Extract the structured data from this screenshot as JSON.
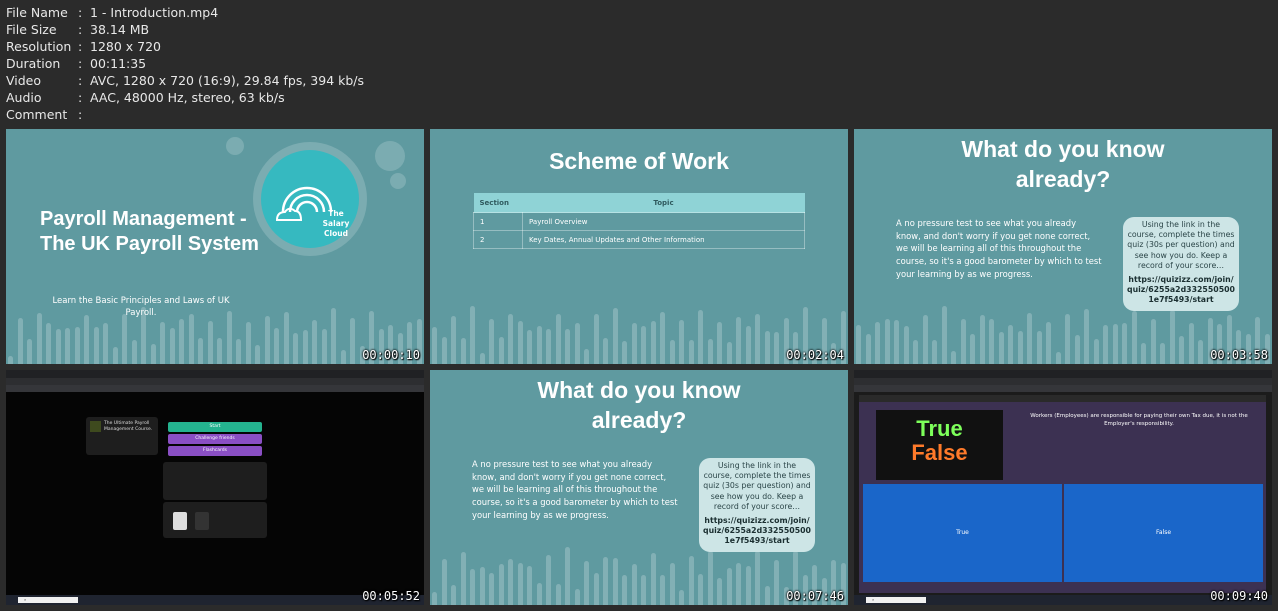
{
  "file_info": [
    {
      "key": "File Name",
      "value": "1 - Introduction.mp4"
    },
    {
      "key": "File Size",
      "value": "38.14 MB"
    },
    {
      "key": "Resolution",
      "value": "1280 x 720"
    },
    {
      "key": "Duration",
      "value": "00:11:35"
    },
    {
      "key": "Video",
      "value": "AVC, 1280 x 720 (16:9), 29.84 fps, 394 kb/s"
    },
    {
      "key": "Audio",
      "value": "AAC, 48000 Hz, stereo, 63 kb/s"
    },
    {
      "key": "Comment",
      "value": ""
    }
  ],
  "thumbs": {
    "t1": {
      "title": "Payroll Management - The UK Payroll System",
      "subtitle": "Learn the Basic Principles and Laws of UK Payroll.",
      "logo_text": "The Salary Cloud",
      "timestamp": "00:00:10"
    },
    "t2": {
      "title": "Scheme of Work",
      "header_section": "Section",
      "header_topic": "Topic",
      "rows": [
        {
          "section": "1",
          "topic": "Payroll Overview"
        },
        {
          "section": "2",
          "topic": "Key Dates, Annual Updates and Other Information"
        }
      ],
      "timestamp": "00:02:04"
    },
    "t3": {
      "title": "What do you know already?",
      "body": "A no pressure test to see what you already know, and don't worry if you get none correct, we will be learning all of this throughout the course, so it's a good barometer by which to test your learning by as we progress.",
      "box_text": "Using the link in the course, complete the times quiz (30s per question) and see how you do. Keep a record of your score…",
      "box_url": "https://quizizz.com/join/quiz/6255a2d3325505001e7f5493/start",
      "timestamp": "00:03:58"
    },
    "t4": {
      "quiz_name": "The Ultimate Payroll Management Course.",
      "start": "Start",
      "challenge": "Challenge friends",
      "flashcards": "Flashcards",
      "timestamp": "00:05:52"
    },
    "t5": {
      "title": "What do you know already?",
      "body": "A no pressure test to see what you already know, and don't worry if you get none correct, we will be learning all of this throughout the course, so it's a good barometer by which to test your learning by as we progress.",
      "box_text": "Using the link in the course, complete the times quiz (30s per question) and see how you do. Keep a record of your score…",
      "box_url": "https://quizizz.com/join/quiz/6255a2d3325505001e7f5493/start",
      "timestamp": "00:07:46"
    },
    "t6": {
      "img_line1": "True",
      "img_line2": "False",
      "question": "Workers (Employees) are responsible for paying their own Tax due, it is not the Employer's responsibility.",
      "answer_true": "True",
      "answer_false": "False",
      "timestamp": "00:09:40"
    }
  },
  "colors": {
    "slide_bg": "#5f9aa0",
    "sheet_bg": "#2b2b2b",
    "logo": "#36b9c0",
    "answer_blue": "#1a66c9"
  }
}
